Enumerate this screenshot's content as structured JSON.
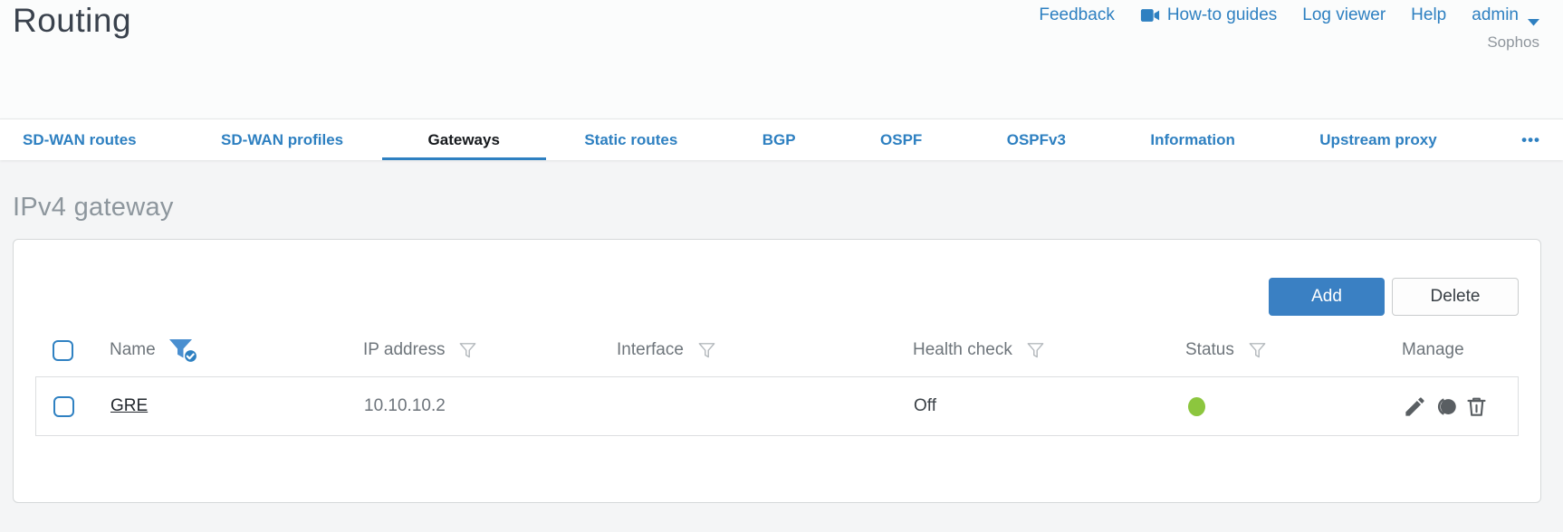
{
  "header": {
    "title": "Routing",
    "nav": {
      "feedback": "Feedback",
      "how_to_guides": "How-to guides",
      "log_viewer": "Log viewer",
      "help": "Help",
      "user": "admin",
      "brand": "Sophos"
    }
  },
  "tabs": [
    {
      "label": "SD-WAN routes",
      "active": false
    },
    {
      "label": "SD-WAN profiles",
      "active": false
    },
    {
      "label": "Gateways",
      "active": true
    },
    {
      "label": "Static routes",
      "active": false
    },
    {
      "label": "BGP",
      "active": false
    },
    {
      "label": "OSPF",
      "active": false
    },
    {
      "label": "OSPFv3",
      "active": false
    },
    {
      "label": "Information",
      "active": false
    },
    {
      "label": "Upstream proxy",
      "active": false
    },
    {
      "label": "•••",
      "active": false
    }
  ],
  "section": {
    "heading": "IPv4 gateway"
  },
  "toolbar": {
    "add": "Add",
    "delete": "Delete"
  },
  "table": {
    "columns": [
      {
        "label": "Name",
        "filter": "active"
      },
      {
        "label": "IP address",
        "filter": "default"
      },
      {
        "label": "Interface",
        "filter": "default"
      },
      {
        "label": "Health check",
        "filter": "default"
      },
      {
        "label": "Status",
        "filter": "default"
      },
      {
        "label": "Manage",
        "filter": "none"
      }
    ],
    "rows": [
      {
        "name": "GRE",
        "ip_address": "10.10.10.2",
        "interface": "",
        "health_check": "Off",
        "status": "up"
      }
    ]
  },
  "icons": {
    "manage": [
      "edit",
      "clone",
      "delete"
    ]
  },
  "colors": {
    "accent_blue": "#2e80c1",
    "button_blue": "#3a80c3",
    "status_green": "#8cc63e"
  }
}
